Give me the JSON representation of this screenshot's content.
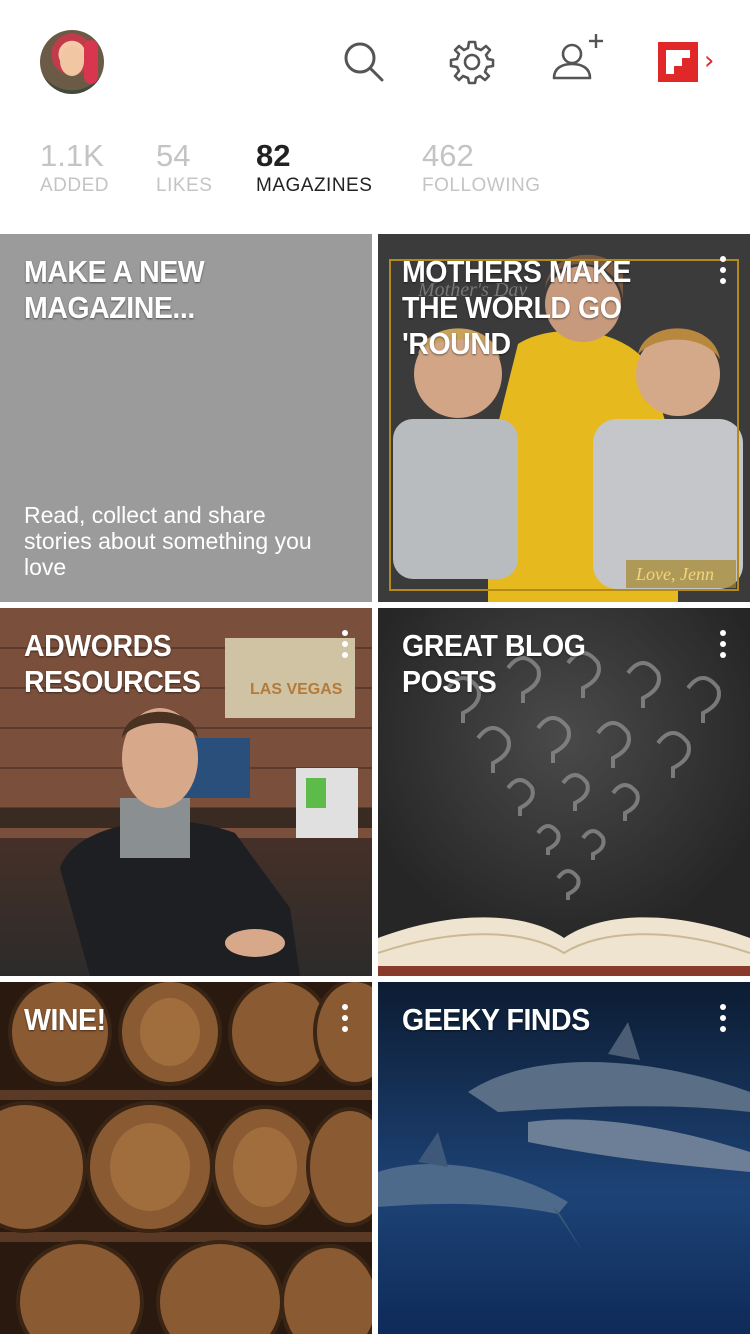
{
  "header": {
    "avatar_alt": "profile-avatar",
    "icons": [
      "search-icon",
      "gear-icon",
      "add-person-icon",
      "flipboard-logo",
      "chevron-right-icon"
    ],
    "brand_color": "#e12828"
  },
  "stats": [
    {
      "value": "1.1K",
      "label": "ADDED",
      "active": false
    },
    {
      "value": "54",
      "label": "LIKES",
      "active": false
    },
    {
      "value": "82",
      "label": "MAGAZINES",
      "active": true
    },
    {
      "value": "462",
      "label": "FOLLOWING",
      "active": false
    }
  ],
  "tiles": [
    {
      "title": "MAKE A NEW MAGAZINE...",
      "description": "Read, collect and share stories about something you love"
    },
    {
      "title": "MOTHERS MAKE THE WORLD GO 'ROUND",
      "image_caption": "Love, Jenn",
      "image_watermark": "Mother's Day"
    },
    {
      "title": "ADWORDS RESOURCES",
      "image_sign": "LAS VEGAS"
    },
    {
      "title": "GREAT BLOG POSTS"
    },
    {
      "title": "WINE!"
    },
    {
      "title": "GEEKY FINDS"
    }
  ],
  "colors": {
    "stat_inactive": "#c4c4c4",
    "stat_active": "#222222",
    "new_tile_bg": "#9b9b9b"
  }
}
